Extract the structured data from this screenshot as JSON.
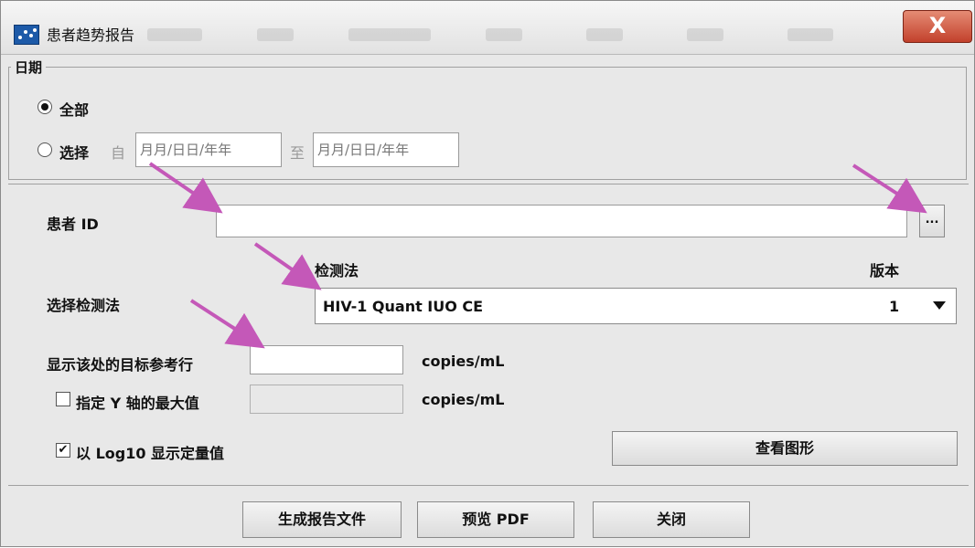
{
  "window": {
    "title": "患者趋势报告",
    "close_glyph": "X"
  },
  "date": {
    "legend": "日期",
    "all_label": "全部",
    "all_selected": true,
    "select_label": "选择",
    "select_selected": false,
    "from_label": "自",
    "from_placeholder": "月月/日日/年年",
    "to_label": "至",
    "to_placeholder": "月月/日日/年年"
  },
  "patient": {
    "label": "患者 ID",
    "value": "",
    "browse_label": "..."
  },
  "assay": {
    "row_label": "选择检测法",
    "header_assay": "检测法",
    "header_version": "版本",
    "selected_assay": "HIV-1 Quant IUO CE",
    "selected_version": "1"
  },
  "target_line": {
    "label": "显示该处的目标参考行",
    "value": "",
    "unit": "copies/mL"
  },
  "y_max": {
    "label": "指定 Y 轴的最大值",
    "checked": false,
    "value": "",
    "unit": "copies/mL"
  },
  "log10": {
    "label": "以 Log10 显示定量值",
    "checked": true,
    "check_glyph": "✔"
  },
  "buttons": {
    "view_graph": "查看图形",
    "generate_report": "生成报告文件",
    "preview_pdf": "预览 PDF",
    "close": "关闭"
  },
  "colors": {
    "annotation_arrow": "#c458b8",
    "close_button": "#c2412c"
  }
}
